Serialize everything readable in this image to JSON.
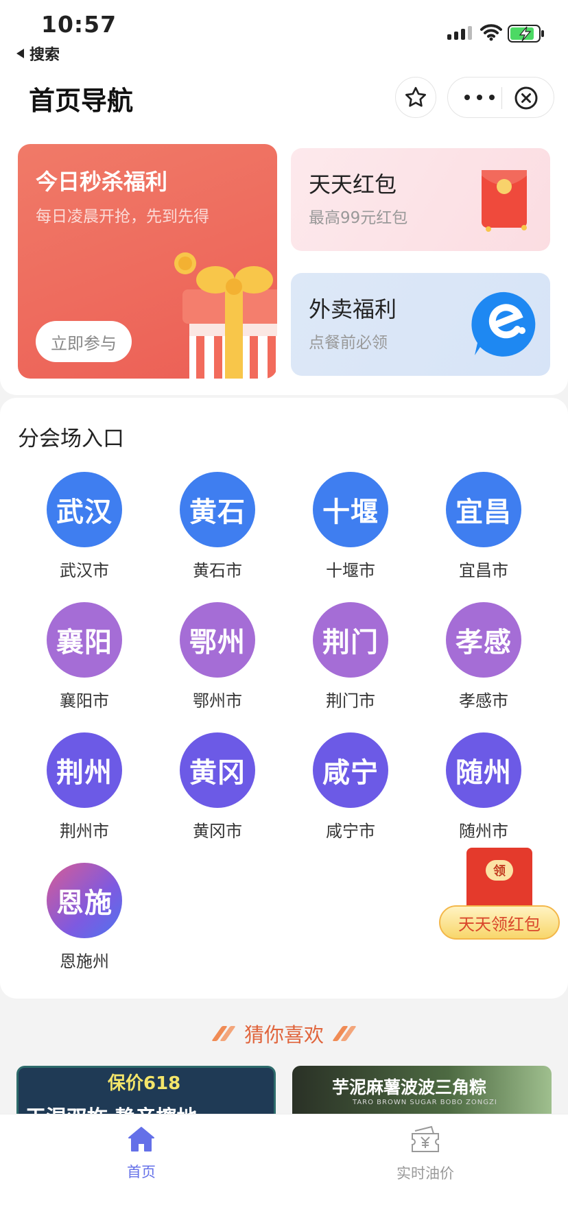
{
  "status_bar": {
    "time": "10:57",
    "back_app": "搜索"
  },
  "nav": {
    "title": "首页导航"
  },
  "promo": {
    "big": {
      "title": "今日秒杀福利",
      "subtitle": "每日凌晨开抢，先到先得",
      "button": "立即参与"
    },
    "red_packet": {
      "title": "天天红包",
      "subtitle": "最高99元红包"
    },
    "takeout": {
      "title": "外卖福利",
      "subtitle": "点餐前必领"
    }
  },
  "venue": {
    "title": "分会场入口",
    "cities": [
      {
        "short": "武汉",
        "name": "武汉市"
      },
      {
        "short": "黄石",
        "name": "黄石市"
      },
      {
        "short": "十堰",
        "name": "十堰市"
      },
      {
        "short": "宜昌",
        "name": "宜昌市"
      },
      {
        "short": "襄阳",
        "name": "襄阳市"
      },
      {
        "short": "鄂州",
        "name": "鄂州市"
      },
      {
        "short": "荆门",
        "name": "荆门市"
      },
      {
        "short": "孝感",
        "name": "孝感市"
      },
      {
        "short": "荆州",
        "name": "荆州市"
      },
      {
        "short": "黄冈",
        "name": "黄冈市"
      },
      {
        "short": "咸宁",
        "name": "咸宁市"
      },
      {
        "short": "随州",
        "name": "随州市"
      },
      {
        "short": "恩施",
        "name": "恩施州"
      }
    ]
  },
  "float_redpack": {
    "seal": "领",
    "label": "天天领红包"
  },
  "guess": {
    "title": "猜你喜欢"
  },
  "products": [
    {
      "tag": "保价618",
      "text": "干湿双拖 静音擦地"
    },
    {
      "tag": "芋泥麻薯波波三角粽",
      "text": "TARO BROWN SUGAR BOBO ZONGZI"
    }
  ],
  "tabs": [
    {
      "label": "首页",
      "icon": "home-icon",
      "active": true
    },
    {
      "label": "实时油价",
      "icon": "ticket-icon",
      "active": false
    }
  ],
  "colors": {
    "accent": "#6470e8",
    "blue": "#3f7ef0",
    "purple": "#a56dd6",
    "indigo": "#6c5ae6",
    "promo_red": "#ec5f55"
  }
}
